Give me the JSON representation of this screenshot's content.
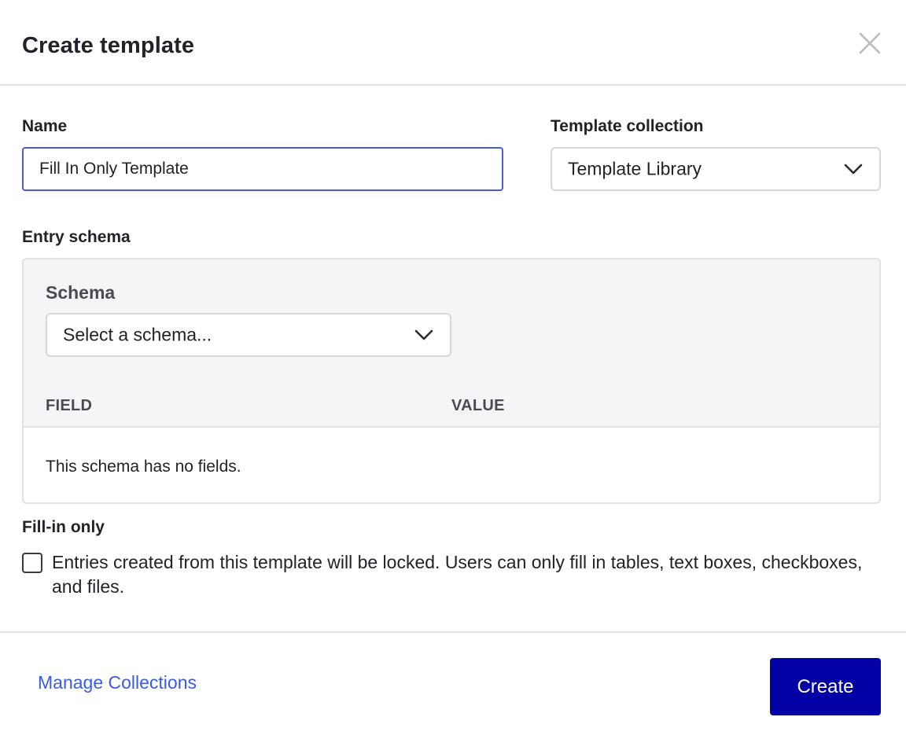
{
  "dialog": {
    "title": "Create template",
    "close_icon": "close-icon"
  },
  "name_field": {
    "label": "Name",
    "value": "Fill In Only Template"
  },
  "collection_field": {
    "label": "Template collection",
    "selected": "Template Library",
    "icon": "chevron-down-icon"
  },
  "entry_schema": {
    "label": "Entry schema",
    "schema_label": "Schema",
    "schema_select_placeholder": "Select a schema...",
    "columns": [
      "FIELD",
      "VALUE"
    ],
    "empty_message": "This schema has no fields."
  },
  "fill_in_only": {
    "label": "Fill-in only",
    "checked": false,
    "description": "Entries created from this template will be locked. Users can only fill in tables, text boxes, checkboxes, and files."
  },
  "footer": {
    "manage_link": "Manage Collections",
    "create_button": "Create"
  },
  "colors": {
    "primary_button": "#0101a6",
    "link": "#3b5ce6",
    "focus_border": "#4d5bd9"
  }
}
